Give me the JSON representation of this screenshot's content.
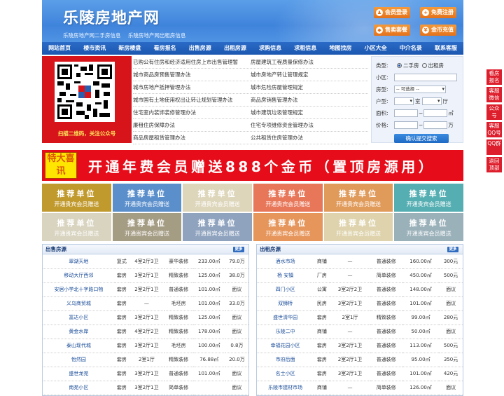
{
  "header": {
    "logo": "乐陵房地产网",
    "sublinks": [
      "乐陵房地产网二手房信息",
      "乐陵房地产网出租房信息"
    ],
    "buttons": [
      {
        "label": "会员登录",
        "icon": "user-icon"
      },
      {
        "label": "免费注册",
        "icon": "plus-icon"
      },
      {
        "label": "售卖套餐",
        "icon": "package-icon"
      },
      {
        "label": "金币充值",
        "icon": "coin-icon"
      }
    ]
  },
  "nav": [
    "网站首页",
    "楼市资讯",
    "新房楼盘",
    "看房报名",
    "出售房源",
    "出租房源",
    "求购信息",
    "求租信息",
    "地图找房",
    "小区大全",
    "中介名录",
    "联系客服"
  ],
  "qr": {
    "caption": "扫描二维码，关注公众号"
  },
  "links": [
    [
      "已购公有住房和经济适用住房上市出售管理暂",
      "房屋建筑工程质量保修办法"
    ],
    [
      "城市商品房预售管理办法",
      "城市房地产转让管理规定"
    ],
    [
      "城市房地产抵押管理办法",
      "城市危险房屋管理规定"
    ],
    [
      "城市国有土地使用权出让转让规划管理办法",
      "商品房销售管理办法"
    ],
    [
      "住宅室内装饰装修管理办法",
      "城市建筑垃圾管理规定"
    ],
    [
      "廉租住房保障办法",
      "住宅专项维修资金管理办法"
    ],
    [
      "商品房屋租赁管理办法",
      "公共租赁住房管理办法"
    ]
  ],
  "search": {
    "type_label": "类型:",
    "type_opt1": "二手房",
    "type_opt2": "出租房",
    "community_label": "小区:",
    "housetype_label": "房型:",
    "housetype_value": "-- 可选择 --",
    "layout_label": "户型:",
    "room_unit": "室",
    "hall_unit": "厅",
    "area_label": "面积:",
    "area_unit": "㎡",
    "price_label": "价格:",
    "price_unit": "万",
    "tilde": "~",
    "button": "确认提交搜索"
  },
  "banner": {
    "tag": "特大喜讯",
    "text": "开通年费会员赠送888个金币（置顶房源用）"
  },
  "recommend": {
    "title": "推荐单位",
    "sub": "开通贵宾会员赠送",
    "colors": [
      "#c19a2e",
      "#5b8fcc",
      "#ded6bb",
      "#e8775a",
      "#e09a5a",
      "#55aeb2",
      "#d9d4c0",
      "#a59c84",
      "#8fa3bf",
      "#e6955b",
      "#ded3ac",
      "#9bb1ba"
    ]
  },
  "sale": {
    "title": "出售房源",
    "more": "更多",
    "rows": [
      [
        "翠湖天地",
        "复式",
        "4室2厅3卫",
        "豪华装修",
        "233.00㎡",
        "79.0万"
      ],
      [
        "移动大厅西邻",
        "套房",
        "3室2厅1卫",
        "精致装修",
        "125.00㎡",
        "38.0万"
      ],
      [
        "安居小学北十字路口物",
        "套房",
        "2室2厅1卫",
        "普通装修",
        "101.00㎡",
        "面议"
      ],
      [
        "义乌商贸城",
        "套房",
        "—",
        "毛坯房",
        "101.00㎡",
        "33.0万"
      ],
      [
        "富达小区",
        "套房",
        "3室2厅1卫",
        "精致装修",
        "125.00㎡",
        "面议"
      ],
      [
        "黄金水岸",
        "套房",
        "4室2厅2卫",
        "精致装修",
        "178.00㎡",
        "面议"
      ],
      [
        "泰山现代城",
        "套房",
        "3室2厅1卫",
        "毛坯房",
        "100.00㎡",
        "0.8万"
      ],
      [
        "怡然园",
        "套房",
        "2室1厅",
        "精致装修",
        "76.88㎡",
        "20.0万"
      ],
      [
        "盛世龙苑",
        "套房",
        "3室2厅1卫",
        "普通装修",
        "101.00㎡",
        "面议"
      ],
      [
        "南苑小区",
        "套房",
        "3室2厅1卫",
        "简单装修",
        "",
        "面议"
      ]
    ]
  },
  "rent": {
    "title": "出租房源",
    "more": "更多",
    "rows": [
      [
        "酒水市场",
        "商铺",
        "—",
        "普通装修",
        "160.00㎡",
        "300元"
      ],
      [
        "杨 安镇",
        "厂房",
        "—",
        "简单装修",
        "450.00㎡",
        "500元"
      ],
      [
        "四门小区",
        "公寓",
        "3室2厅2卫",
        "普通装修",
        "148.00㎡",
        "面议"
      ],
      [
        "双狮桥",
        "民房",
        "3室2厅1卫",
        "普通装修",
        "101.00㎡",
        "面议"
      ],
      [
        "盛世清华园",
        "套房",
        "2室1厅",
        "精致装修",
        "99.00㎡",
        "280元"
      ],
      [
        "乐陵二中",
        "商铺",
        "—",
        "普通装修",
        "50.00㎡",
        "面议"
      ],
      [
        "幸福花园小区",
        "套房",
        "3室2厅1卫",
        "普通装修",
        "113.00㎡",
        "500元"
      ],
      [
        "市府后面",
        "套房",
        "2室2厅1卫",
        "普通装修",
        "95.00㎡",
        "350元"
      ],
      [
        "名士小区",
        "套房",
        "3室2厅1卫",
        "普通装修",
        "101.00㎡",
        "420元"
      ],
      [
        "乐陵市建材市场",
        "商铺",
        "—",
        "简单装修",
        "126.00㎡",
        "面议"
      ]
    ]
  },
  "side": [
    "看房报名",
    "客服微信",
    "公众号",
    "客服QQ号",
    "QQ群",
    "返回顶部"
  ]
}
